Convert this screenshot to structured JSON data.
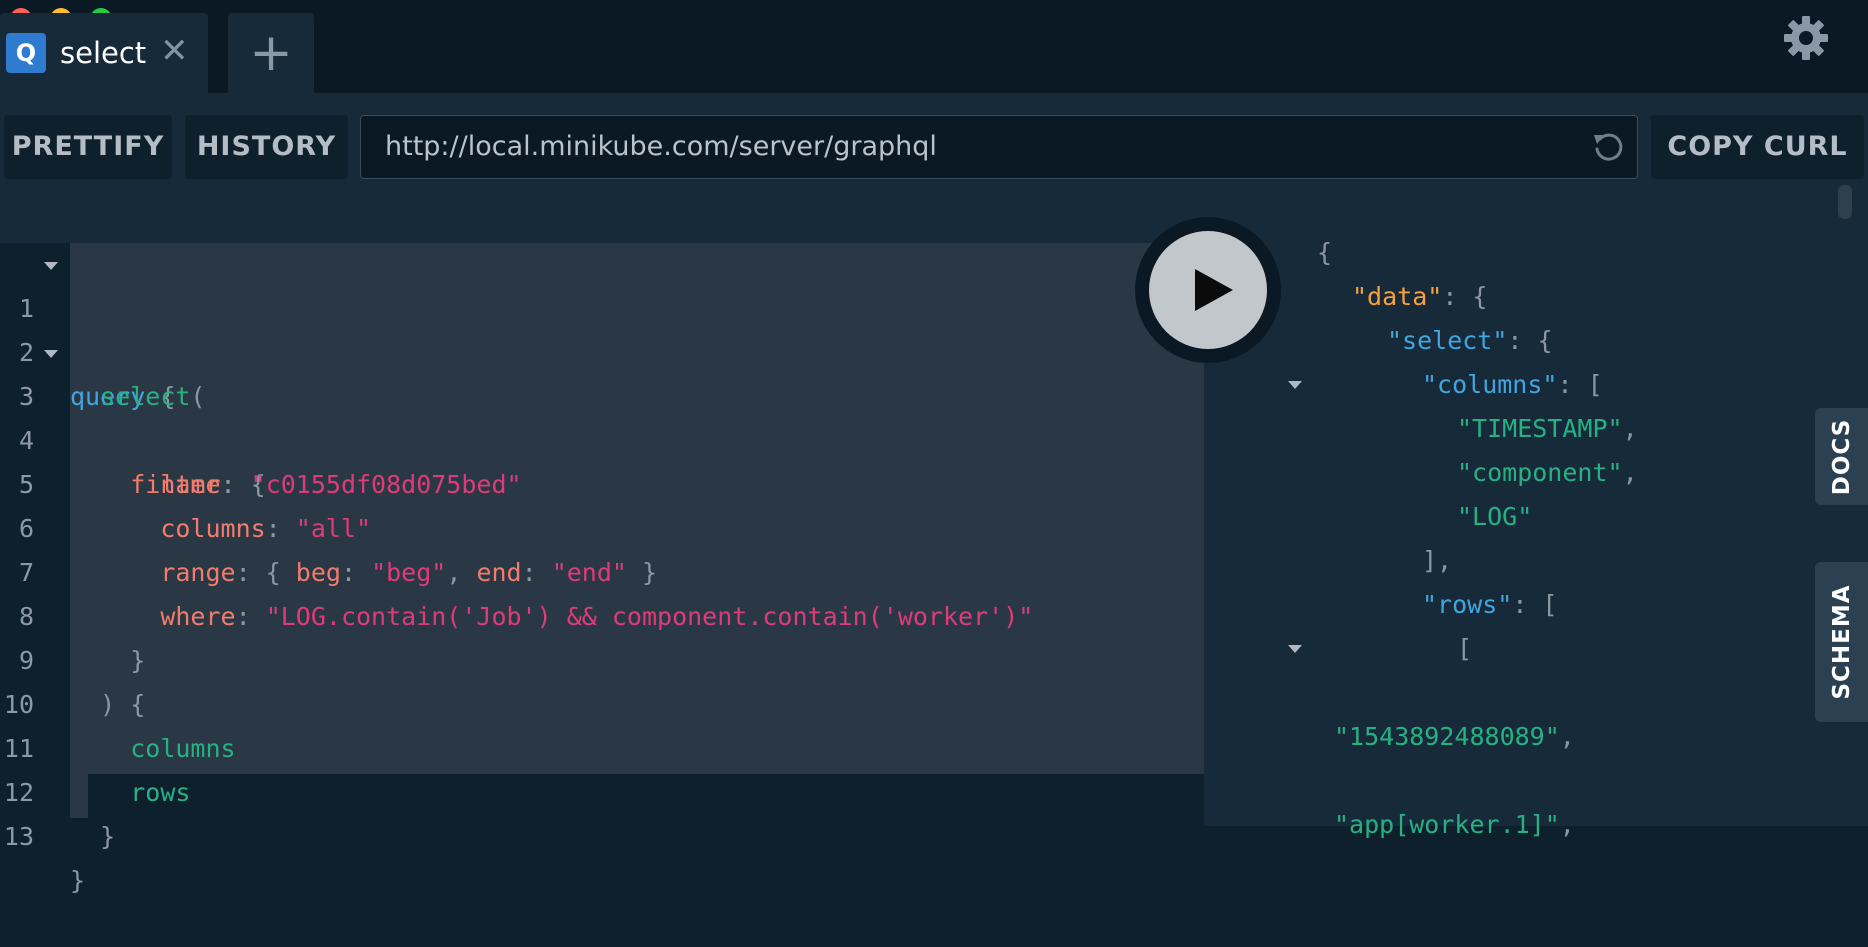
{
  "tabs": [
    {
      "badge": "Q",
      "title": "select",
      "close": "✕"
    }
  ],
  "add_tab_label": "+",
  "toolbar": {
    "prettify_label": "PRETTIFY",
    "history_label": "HISTORY",
    "url": "http://local.minikube.com/server/graphql",
    "copy_curl_label": "COPY CURL"
  },
  "editor": {
    "line_numbers": [
      "1",
      "2",
      "3",
      "4",
      "5",
      "6",
      "7",
      "8",
      "9",
      "10",
      "11",
      "12",
      "13"
    ],
    "lines": {
      "l1": {
        "kw": "query",
        "brace": "{"
      },
      "l2": {
        "fn": "select",
        "paren": "("
      },
      "l3": {
        "arg": "filter",
        "rest": ": {"
      },
      "l4": {
        "arg": "name",
        "sep": ": ",
        "str": "\"c0155df08d075bed\""
      },
      "l5": {
        "arg": "columns",
        "sep": ": ",
        "str": "\"all\""
      },
      "l6": {
        "arg": "range",
        "open": ": { ",
        "k1": "beg",
        "s1": ": ",
        "v1": "\"beg\"",
        "c": ", ",
        "k2": "end",
        "s2": ": ",
        "v2": "\"end\"",
        "close": " }"
      },
      "l7": {
        "arg": "where",
        "sep": ": ",
        "str": "\"LOG.contain('Job') && component.contain('worker')\""
      },
      "l8": {
        "brace": "}"
      },
      "l9": {
        "brace": ") {"
      },
      "l10": {
        "fn": "columns"
      },
      "l11": {
        "fn": "rows"
      },
      "l12": {
        "brace": "}"
      },
      "l13": {
        "brace": "}"
      }
    }
  },
  "result": {
    "r1": "{",
    "r2": {
      "key": "\"data\"",
      "rest": ": {"
    },
    "r3": {
      "key": "\"select\"",
      "rest": ": {"
    },
    "r4": {
      "key": "\"columns\"",
      "rest": ": ["
    },
    "r5": {
      "val": "\"TIMESTAMP\"",
      "rest": ","
    },
    "r6": {
      "val": "\"component\"",
      "rest": ","
    },
    "r7": {
      "val": "\"LOG\""
    },
    "r8": "],",
    "r9": {
      "key": "\"rows\"",
      "rest": ": ["
    },
    "r10": "[",
    "r11": {
      "val": "\"1543892488089\"",
      "rest": ","
    },
    "r12": {
      "val": "\"app[worker.1]\"",
      "rest": ","
    }
  },
  "side_tabs": {
    "docs": "DOCS",
    "schema": "SCHEMA"
  },
  "icons": [
    "gear-icon",
    "reload-icon",
    "play-icon",
    "close-icon",
    "plus-icon"
  ],
  "colors": {
    "accent": "#2f7bcf",
    "keyword": "#42a5e0",
    "field": "#27b183",
    "argument": "#f27c6c",
    "string": "#df3a7a",
    "data_key": "#f8a13b"
  }
}
